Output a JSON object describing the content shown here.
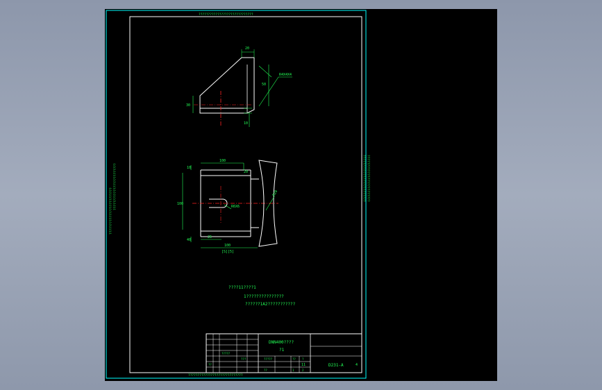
{
  "colors": {
    "background": "#000000",
    "outline": "#ffffff",
    "border": "#00ffff",
    "dimension": "#22ff55",
    "centerline": "#ff2222",
    "desktop": "#96a0b3"
  },
  "frame": {
    "top_note": "?????????????????????????????",
    "left_note_outer": "?????????????????????????",
    "left_note_inner": "?????????????????????????",
    "right_note_outer": "?????????????????????????",
    "right_note_inner": "?????????????????????????",
    "bottom_note": "?????????????????????????????"
  },
  "views": {
    "top": {
      "dims": [
        "20",
        "50",
        "R4X4X4",
        "30",
        "10"
      ]
    },
    "bottom": {
      "dims": [
        "10",
        "100",
        "100",
        "20",
        "40",
        "25",
        "100",
        "R6X6",
        "R20"
      ],
      "label": "[S][5]"
    }
  },
  "notes": [
    "????11????1",
    "1???????????????",
    "??????1A2???????????"
  ],
  "title_block": {
    "drawing_title": "DNN400????",
    "subtitle": "?1",
    "drawing_no": "D231-A",
    "sheet": "4",
    "row_a": [
      "?????",
      "??",
      "?"
    ],
    "row_b": [
      "??",
      "1",
      "2"
    ],
    "left_cells": [
      "?????",
      "???",
      "??"
    ],
    "scale": "11"
  }
}
